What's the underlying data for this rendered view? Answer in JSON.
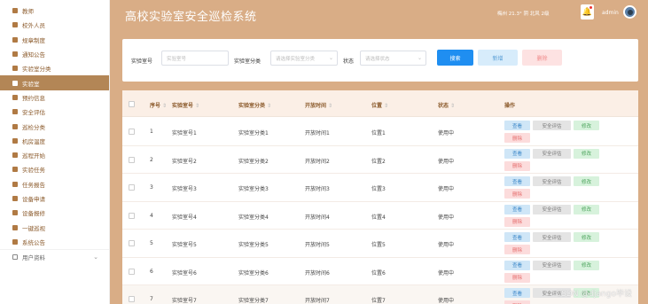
{
  "sidebar": {
    "items": [
      {
        "label": "教师",
        "active": false
      },
      {
        "label": "校外人员",
        "active": false
      },
      {
        "label": "规章制度",
        "active": false
      },
      {
        "label": "通知公告",
        "active": false
      },
      {
        "label": "实验室分类",
        "active": false
      },
      {
        "label": "实验室",
        "active": true
      },
      {
        "label": "预约信息",
        "active": false
      },
      {
        "label": "安全评估",
        "active": false
      },
      {
        "label": "巡检分类",
        "active": false
      },
      {
        "label": "机房温度",
        "active": false
      },
      {
        "label": "巡程开始",
        "active": false
      },
      {
        "label": "实验任务",
        "active": false
      },
      {
        "label": "任务报告",
        "active": false
      },
      {
        "label": "设备申请",
        "active": false
      },
      {
        "label": "设备报修",
        "active": false
      },
      {
        "label": "一键巡视",
        "active": false
      },
      {
        "label": "系统公告",
        "active": false
      }
    ],
    "footer_item": "用户资料"
  },
  "header": {
    "title": "高校实验室安全巡检系统",
    "weather": "梅州  21.3°  阴  北风  2级",
    "user": "admin"
  },
  "search": {
    "room_label": "实验室号",
    "room_placeholder": "实验室号",
    "category_label": "实验室分类",
    "category_placeholder": "请选择实验室分类",
    "status_label": "状态",
    "status_placeholder": "请选择状态",
    "search_btn": "搜索",
    "add_btn": "新增",
    "delete_btn": "删除"
  },
  "table": {
    "headers": [
      "序号",
      "实验室号",
      "实验室分类",
      "开放时间",
      "位置",
      "状态",
      "操作"
    ],
    "actions": {
      "view": "查看",
      "eval": "安全评估",
      "edit": "修改",
      "delete": "删除"
    },
    "rows": [
      {
        "no": "1",
        "room": "实验室号1",
        "category": "实验室分类1",
        "open": "开放时间1",
        "loc": "位置1",
        "status": "使用中"
      },
      {
        "no": "2",
        "room": "实验室号2",
        "category": "实验室分类2",
        "open": "开放时间2",
        "loc": "位置2",
        "status": "使用中"
      },
      {
        "no": "3",
        "room": "实验室号3",
        "category": "实验室分类3",
        "open": "开放时间3",
        "loc": "位置3",
        "status": "使用中"
      },
      {
        "no": "4",
        "room": "实验室号4",
        "category": "实验室分类4",
        "open": "开放时间4",
        "loc": "位置4",
        "status": "使用中"
      },
      {
        "no": "5",
        "room": "实验室号5",
        "category": "实验室分类5",
        "open": "开放时间5",
        "loc": "位置5",
        "status": "使用中"
      },
      {
        "no": "6",
        "room": "实验室号6",
        "category": "实验室分类6",
        "open": "开放时间6",
        "loc": "位置6",
        "status": "使用中"
      },
      {
        "no": "7",
        "room": "实验室号7",
        "category": "实验室分类7",
        "open": "开放时间7",
        "loc": "位置7",
        "status": "使用中"
      }
    ]
  },
  "watermark": "CSDN @django毕设"
}
